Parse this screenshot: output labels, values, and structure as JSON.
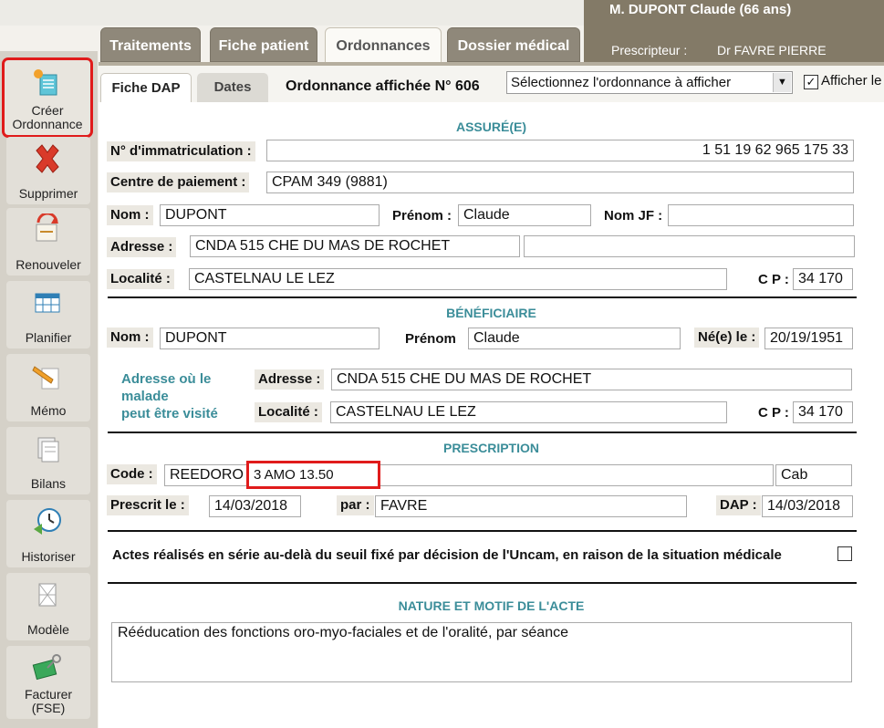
{
  "header": {
    "patient_name": "M. DUPONT Claude (66 ans)",
    "prescripteur_label": "Prescripteur :",
    "prescripteur_value": "Dr FAVRE PIERRE"
  },
  "main_tabs": [
    {
      "label": "Traitements"
    },
    {
      "label": "Fiche patient"
    },
    {
      "label": "Ordonnances"
    },
    {
      "label": "Dossier médical"
    }
  ],
  "sidebar": {
    "items": [
      {
        "label_line1": "Créer",
        "label_line2": "Ordonnance",
        "icon": "create-prescription-icon"
      },
      {
        "label_line1": "Supprimer",
        "label_line2": "",
        "icon": "delete-icon"
      },
      {
        "label_line1": "Renouveler",
        "label_line2": "",
        "icon": "renew-icon"
      },
      {
        "label_line1": "Planifier",
        "label_line2": "",
        "icon": "calendar-grid-icon"
      },
      {
        "label_line1": "Mémo",
        "label_line2": "",
        "icon": "memo-pencil-icon"
      },
      {
        "label_line1": "Bilans",
        "label_line2": "",
        "icon": "documents-icon"
      },
      {
        "label_line1": "Historiser",
        "label_line2": "",
        "icon": "history-clock-icon"
      },
      {
        "label_line1": "Modèle",
        "label_line2": "",
        "icon": "template-icon"
      },
      {
        "label_line1": "Facturer",
        "label_line2": "(FSE)",
        "icon": "billing-card-icon"
      }
    ]
  },
  "sub_tabs": [
    {
      "label": "Fiche DAP"
    },
    {
      "label": "Dates"
    }
  ],
  "ordonnance": {
    "label": "Ordonnance affichée N° 606",
    "select_value": "Sélectionnez l'ordonnance à afficher",
    "afficher_label": "Afficher le"
  },
  "assure": {
    "title": "ASSURÉ(E)",
    "immat_label": "N° d'immatriculation :",
    "immat_value": "1 51 19 62 965 175 33",
    "centre_label": "Centre de paiement :",
    "centre_value": "CPAM 349 (9881)",
    "nom_label": "Nom :",
    "nom_value": "DUPONT",
    "prenom_label": "Prénom :",
    "prenom_value": "Claude",
    "nomjf_label": "Nom JF :",
    "nomjf_value": "",
    "adresse_label": "Adresse :",
    "adresse_value": "CNDA 515 CHE DU MAS DE ROCHET",
    "adresse2_value": "",
    "localite_label": "Localité :",
    "localite_value": "CASTELNAU LE LEZ",
    "cp_label": "C P :",
    "cp_value": "34 170"
  },
  "beneficiaire": {
    "title": "BÉNÉFICIAIRE",
    "nom_label": "Nom :",
    "nom_value": "DUPONT",
    "prenom_label": "Prénom",
    "prenom_value": "Claude",
    "ne_label": "Né(e) le :",
    "ne_value": "20/19/1951",
    "adresse_visite_line1": "Adresse où le",
    "adresse_visite_line2": "malade",
    "adresse_visite_line3": "peut être visité",
    "adresse_label": "Adresse :",
    "adresse_value": "CNDA 515 CHE DU MAS DE ROCHET",
    "localite_label": "Localité :",
    "localite_value": "CASTELNAU LE LEZ",
    "cp_label": "C P :",
    "cp_value": "34 170"
  },
  "prescription": {
    "title": "PRESCRIPTION",
    "code_label": "Code :",
    "code_value": "REEDORO",
    "cotation_value": "3 AMO 13.50",
    "lieu_value": "Cab",
    "prescrit_label": "Prescrit le :",
    "prescrit_value": "14/03/2018",
    "par_label": "par :",
    "par_value": "FAVRE",
    "dap_label": "DAP :",
    "dap_value": "14/03/2018",
    "serie_label": "Actes réalisés en série au-delà du seuil fixé par décision de l'Uncam, en raison de la situation médicale"
  },
  "nature": {
    "title": "NATURE ET MOTIF DE L'ACTE",
    "text": "Rééducation des fonctions oro-myo-faciales et de l'oralité, par séance"
  },
  "colors": {
    "accent_teal": "#3b8d99",
    "tab_brown": "#8f887a",
    "highlight_red": "#e01b1b"
  }
}
